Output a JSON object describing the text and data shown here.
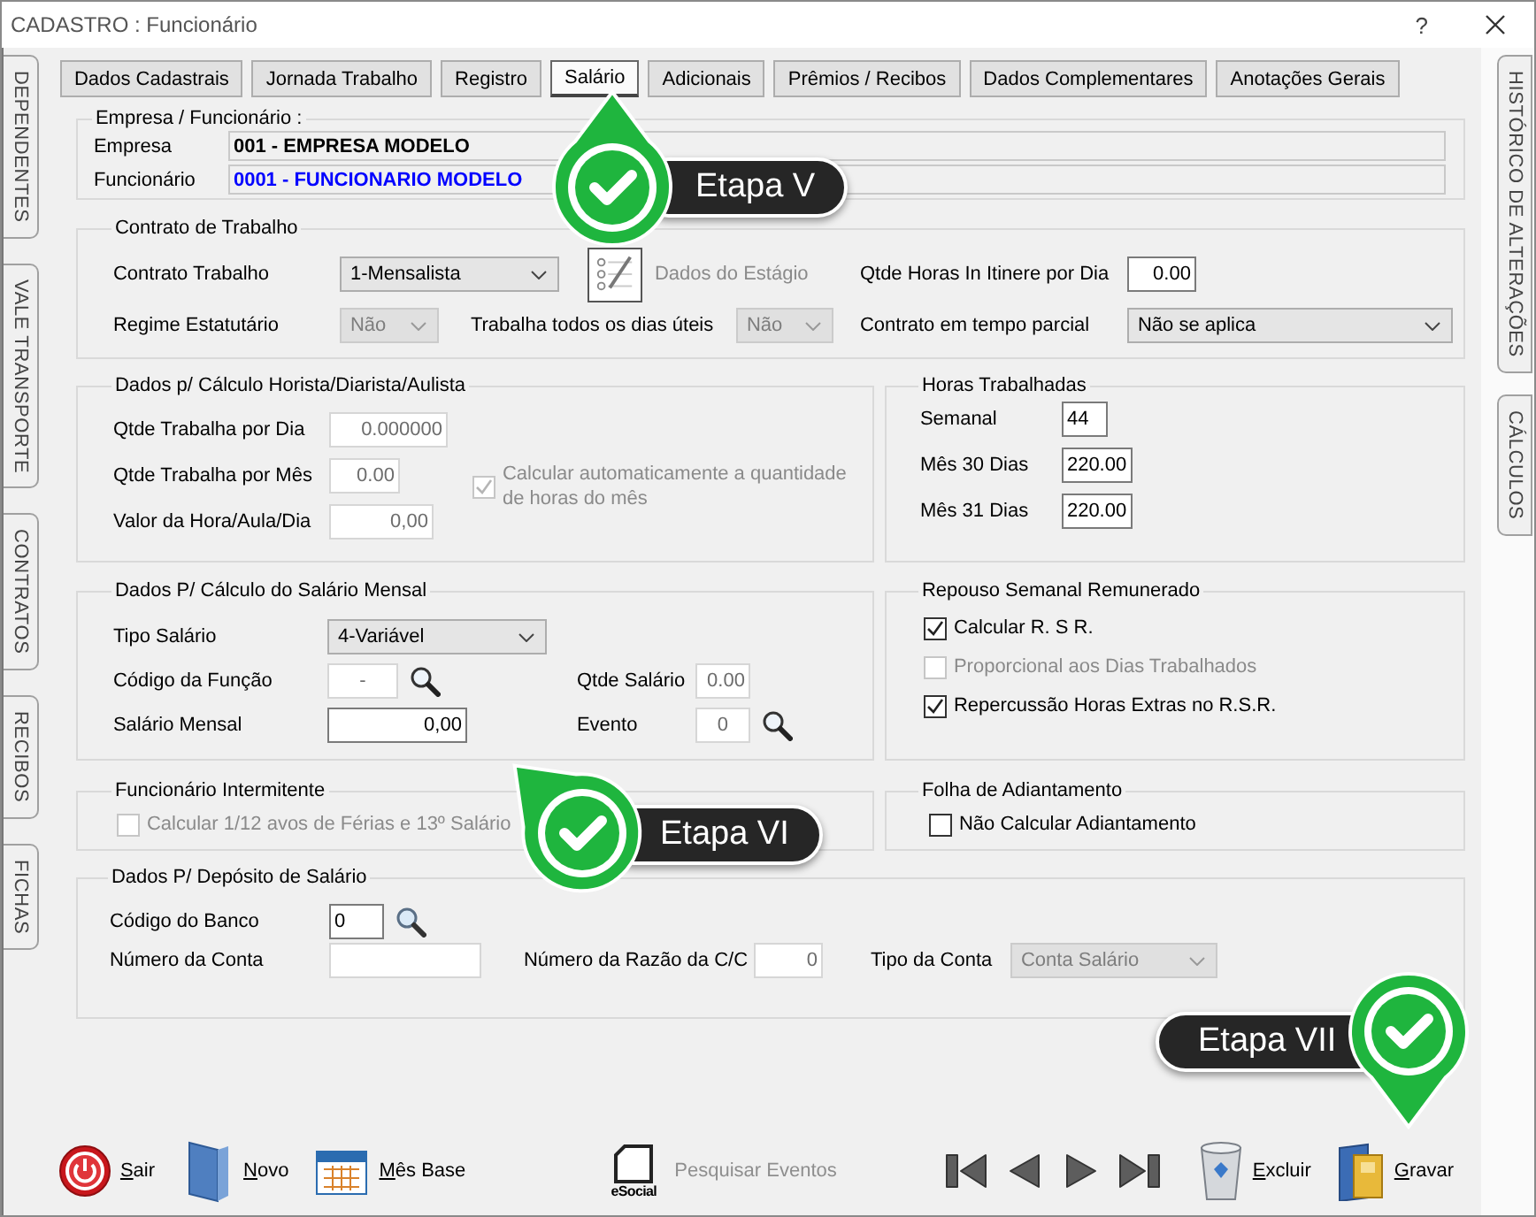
{
  "window": {
    "title": "CADASTRO : Funcionário",
    "help": "?"
  },
  "left_tabs": [
    {
      "label": "DEPENDENTES"
    },
    {
      "label": "VALE TRANSPORTE"
    },
    {
      "label": "CONTRATOS"
    },
    {
      "label": "RECIBOS"
    },
    {
      "label": "FICHAS"
    }
  ],
  "right_tabs": [
    {
      "label": "HISTÓRICO DE ALTERAÇÕES"
    },
    {
      "label": "CÁLCULOS"
    }
  ],
  "tabs": [
    {
      "label": "Dados Cadastrais",
      "selected": false
    },
    {
      "label": "Jornada Trabalho",
      "selected": false
    },
    {
      "label": "Registro",
      "selected": false
    },
    {
      "label": "Salário",
      "selected": true
    },
    {
      "label": "Adicionais",
      "selected": false
    },
    {
      "label": "Prêmios / Recibos",
      "selected": false
    },
    {
      "label": "Dados Complementares",
      "selected": false
    },
    {
      "label": "Anotações Gerais",
      "selected": false
    }
  ],
  "empresa_funcionario": {
    "title": "Empresa / Funcionário :",
    "rows": [
      {
        "label": "Empresa",
        "value": "001 - EMPRESA MODELO",
        "color": "#000000"
      },
      {
        "label": "Funcionário",
        "value": "0001 - FUNCIONARIO MODELO",
        "color": "#0000ff"
      }
    ]
  },
  "contrato": {
    "title": "Contrato de Trabalho",
    "contrato_trabalho": {
      "label": "Contrato Trabalho",
      "value": "1-Mensalista",
      "disabled": false
    },
    "dados_estagio": {
      "label": "Dados do Estágio",
      "disabled": true
    },
    "horas_in_itinere": {
      "label": "Qtde Horas In Itinere por Dia",
      "value": "0.00",
      "disabled": false
    },
    "regime_estatutario": {
      "label": "Regime Estatutário",
      "value": "Não",
      "disabled": true
    },
    "trabalha_dias_uteis": {
      "label": "Trabalha todos os dias úteis",
      "value": "Não",
      "disabled": true
    },
    "tempo_parcial": {
      "label": "Contrato em tempo parcial",
      "value": "Não se aplica",
      "disabled": false
    }
  },
  "horista": {
    "title": "Dados p/ Cálculo Horista/Diarista/Aulista",
    "fields": [
      {
        "label": "Qtde Trabalha por Dia",
        "value": "0.000000",
        "disabled": true
      },
      {
        "label": "Qtde Trabalha por Mês",
        "value": "0.00",
        "disabled": true
      },
      {
        "label": "Valor da Hora/Aula/Dia",
        "value": "0,00",
        "disabled": true
      }
    ],
    "auto_calc": {
      "label": "Calcular automaticamente a quantidade de horas do mês",
      "checked": true,
      "disabled": true
    }
  },
  "horas_trabalhadas": {
    "title": "Horas Trabalhadas",
    "fields": [
      {
        "label": "Semanal",
        "value": "44",
        "disabled": false
      },
      {
        "label": "Mês 30 Dias",
        "value": "220.00",
        "disabled": false
      },
      {
        "label": "Mês 31 Dias",
        "value": "220.00",
        "disabled": false
      }
    ]
  },
  "salario_mensal": {
    "title": "Dados P/ Cálculo do Salário Mensal",
    "tipo_salario": {
      "label": "Tipo Salário",
      "value": "4-Variável",
      "disabled": false
    },
    "codigo_funcao": {
      "label": "Código da Função",
      "value": "-",
      "disabled": true
    },
    "qtde_salario": {
      "label": "Qtde Salário",
      "value": "0.00",
      "disabled": true
    },
    "salario_mensal": {
      "label": "Salário Mensal",
      "value": "0,00",
      "disabled": false
    },
    "evento": {
      "label": "Evento",
      "value": "0",
      "disabled": true
    }
  },
  "repouso": {
    "title": "Repouso Semanal Remunerado",
    "options": [
      {
        "label": "Calcular R. S R.",
        "checked": true,
        "disabled": false
      },
      {
        "label": "Proporcional aos Dias Trabalhados",
        "checked": false,
        "disabled": true
      },
      {
        "label": "Repercussão Horas Extras no R.S.R.",
        "checked": true,
        "disabled": false
      }
    ]
  },
  "intermitente": {
    "title": "Funcionário Intermitente",
    "option": {
      "label": "Calcular 1/12 avos de Férias e 13º Salário",
      "checked": false,
      "disabled": true
    }
  },
  "adiantamento": {
    "title": "Folha de Adiantamento",
    "option": {
      "label": "Não Calcular Adiantamento",
      "checked": false,
      "disabled": false
    }
  },
  "deposito": {
    "title": "Dados P/ Depósito de Salário",
    "codigo_banco": {
      "label": "Código do Banco",
      "value": "0",
      "disabled": false
    },
    "numero_conta": {
      "label": "Número da Conta",
      "disabled": true
    },
    "razao_cc": {
      "label": "Número da Razão da C/C",
      "value": "0",
      "disabled": true
    },
    "tipo_conta": {
      "label": "Tipo da Conta",
      "value": "Conta Salário",
      "disabled": true
    }
  },
  "toolbar": {
    "buttons": [
      {
        "kind": "exit",
        "label": "Sair"
      },
      {
        "kind": "new",
        "label": "Novo"
      },
      {
        "kind": "calendar",
        "label": "Mês Base"
      }
    ],
    "esocial": {
      "logo": "eSocial",
      "label": "Pesquisar Eventos",
      "disabled": true
    },
    "navigation": [
      {
        "kind": "first"
      },
      {
        "kind": "previous"
      },
      {
        "kind": "next"
      },
      {
        "kind": "last"
      }
    ],
    "actions": [
      {
        "kind": "delete",
        "label": "Excluir"
      },
      {
        "kind": "save",
        "label": "Gravar"
      }
    ]
  },
  "callouts": [
    {
      "label": "Etapa V"
    },
    {
      "label": "Etapa VI"
    },
    {
      "label": "Etapa VII"
    }
  ]
}
